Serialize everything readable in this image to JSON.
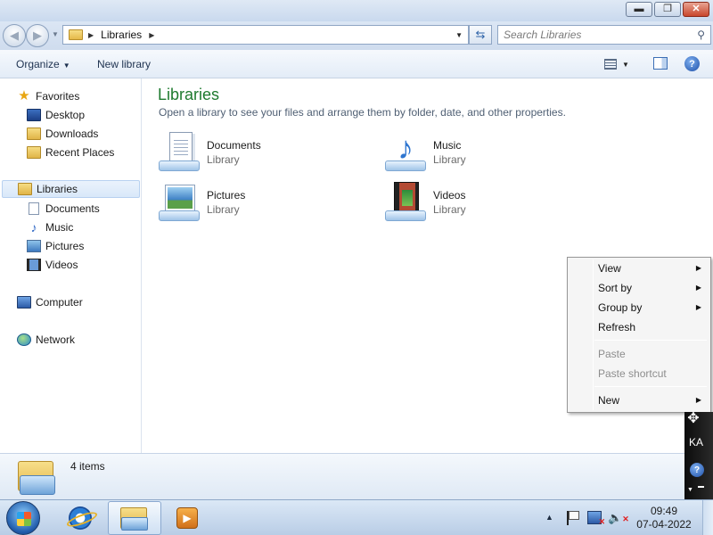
{
  "window": {
    "minimize_glyph": "▬",
    "maximize_glyph": "❐",
    "close_glyph": "✕"
  },
  "address": {
    "crumb": "Libraries",
    "search_placeholder": "Search Libraries"
  },
  "toolbar": {
    "organize_label": "Organize",
    "new_library_label": "New library"
  },
  "nav": {
    "favorites": "Favorites",
    "desktop": "Desktop",
    "downloads": "Downloads",
    "recent_places": "Recent Places",
    "libraries": "Libraries",
    "documents": "Documents",
    "music": "Music",
    "pictures": "Pictures",
    "videos": "Videos",
    "computer": "Computer",
    "network": "Network"
  },
  "content": {
    "title": "Libraries",
    "subtitle": "Open a library to see your files and arrange them by folder, date, and other properties.",
    "libraries": [
      {
        "name": "Documents",
        "kind": "Library",
        "icon": "documents-library-icon"
      },
      {
        "name": "Music",
        "kind": "Library",
        "icon": "music-library-icon"
      },
      {
        "name": "Pictures",
        "kind": "Library",
        "icon": "pictures-library-icon"
      },
      {
        "name": "Videos",
        "kind": "Library",
        "icon": "videos-library-icon"
      }
    ]
  },
  "context_menu": {
    "view": "View",
    "sort_by": "Sort by",
    "group_by": "Group by",
    "refresh": "Refresh",
    "paste": "Paste",
    "paste_shortcut": "Paste shortcut",
    "new": "New"
  },
  "details": {
    "item_count": "4 items"
  },
  "gadget": {
    "language": "KA"
  },
  "taskbar": {
    "time": "09:49",
    "date": "07-04-2022"
  },
  "colors": {
    "title_green": "#1e7a2e",
    "accent_blue": "#2f76d0"
  }
}
